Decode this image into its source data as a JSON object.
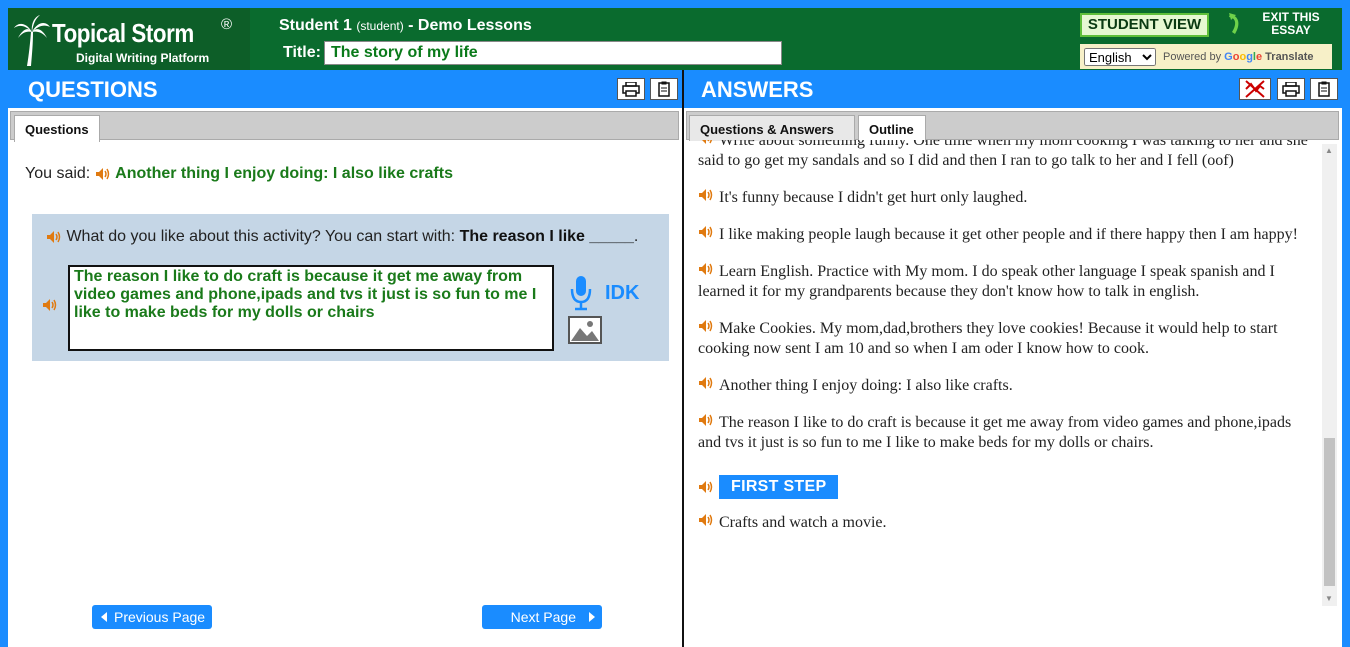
{
  "header": {
    "brand": "Topical Storm",
    "reg": "®",
    "subtitle": "Digital Writing Platform",
    "student_name": "Student 1",
    "student_role": "(student)",
    "lesson": "- Demo Lessons",
    "title_label": "Title:",
    "title_value": "The story of my life",
    "student_view": "STUDENT VIEW",
    "exit_line1": "EXIT THIS",
    "exit_line2": "ESSAY",
    "language": "English",
    "powered_by": "Powered by",
    "google": "Google",
    "translate": "Translate"
  },
  "questions_panel": {
    "heading": "QUESTIONS",
    "tab": "Questions",
    "you_said_label": "You said:",
    "you_said_value": "Another thing I enjoy doing: I also like crafts",
    "prompt": "What do you like about this activity? You can start with:",
    "prompt_starter": "The reason I like _____",
    "prompt_end": ".",
    "answer": "The reason I like to do craft is because it get me away from video games and phone,ipads and tvs it just is so fun to me I like to make beds for my dolls or chairs ",
    "idk": "IDK",
    "prev": "Previous Page",
    "next": "Next Page"
  },
  "answers_panel": {
    "heading": "ANSWERS",
    "tabs": [
      "Questions & Answers",
      "Outline"
    ],
    "paragraphs": [
      "Write about something funny. One time when my mom cooking I was talking to her and she said to go get my sandals and so I did and then I ran to go talk to her and I fell (oof)",
      "It's funny because I didn't get hurt only laughed.",
      "I like making people laugh because it get other people and if there happy then I am happy!",
      "Learn English. Practice with My mom. I do speak other language I speak spanish and I learned it for my grandparents because they don't know how to talk in english.",
      "Make Cookies. My mom,dad,brothers they love cookies! Because it would help to start cooking now sent I am 10 and so when I am oder I know how to cook.",
      "Another thing I enjoy doing: I also like crafts.",
      "The reason I like to do craft is because it get me away from video games and phone,ipads and tvs it just is so fun to me I like to make beds for my dolls or chairs."
    ],
    "first_step": "FIRST STEP",
    "last_paragraph": "Crafts and watch a movie."
  },
  "colors": {
    "accent_blue": "#1a8cff",
    "header_green": "#0a6b2e",
    "answer_green": "#1a7a1a",
    "speaker_orange": "#e07a10"
  }
}
